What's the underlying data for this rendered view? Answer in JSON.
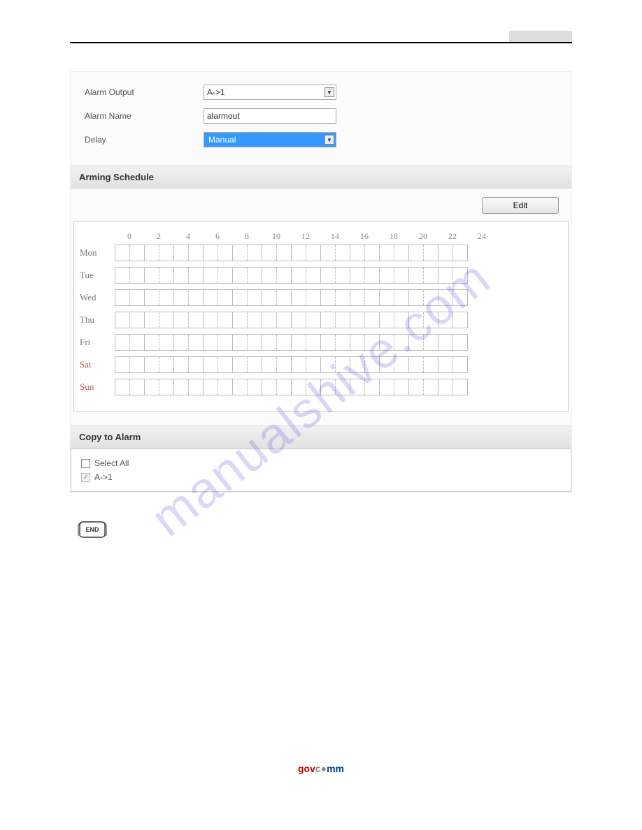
{
  "form": {
    "alarm_output_label": "Alarm Output",
    "alarm_output_value": "A->1",
    "alarm_name_label": "Alarm Name",
    "alarm_name_value": "alarmout",
    "delay_label": "Delay",
    "delay_value": "Manual"
  },
  "sections": {
    "arming_schedule": "Arming Schedule",
    "copy_to_alarm": "Copy to Alarm"
  },
  "buttons": {
    "edit": "Edit"
  },
  "schedule": {
    "hours": [
      "0",
      "2",
      "4",
      "6",
      "8",
      "10",
      "12",
      "14",
      "16",
      "18",
      "20",
      "22",
      "24"
    ],
    "days": [
      {
        "label": "Mon",
        "weekend": false
      },
      {
        "label": "Tue",
        "weekend": false
      },
      {
        "label": "Wed",
        "weekend": false
      },
      {
        "label": "Thu",
        "weekend": false
      },
      {
        "label": "Fri",
        "weekend": false
      },
      {
        "label": "Sat",
        "weekend": true
      },
      {
        "label": "Sun",
        "weekend": true
      }
    ]
  },
  "copy": {
    "select_all": "Select All",
    "items": [
      "A->1"
    ]
  },
  "end_label": "END",
  "watermark": "manualshive.com",
  "footer": {
    "part1": "gov",
    "part2": "c",
    "part3": "mm"
  }
}
